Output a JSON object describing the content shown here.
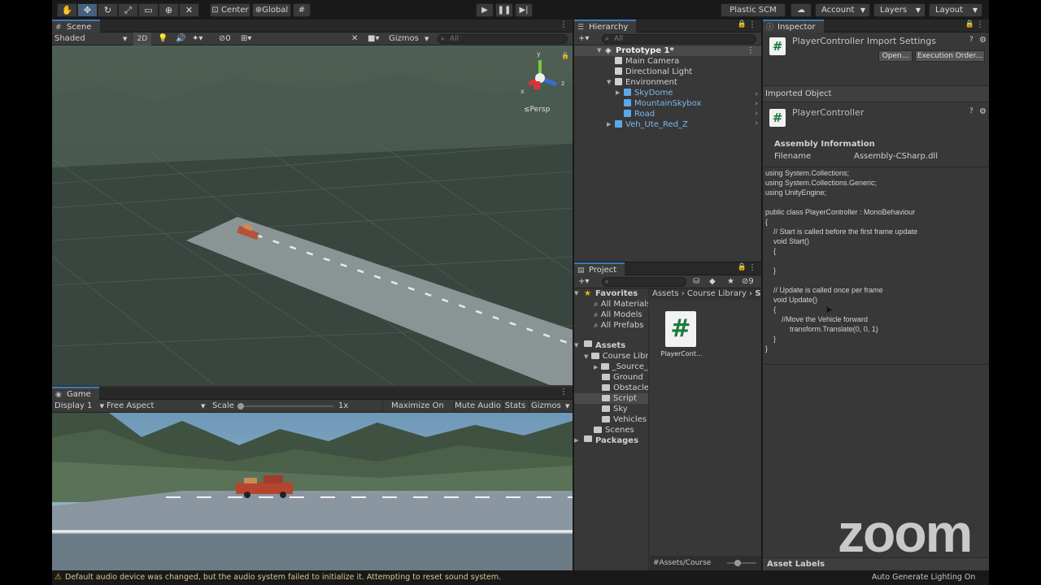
{
  "toolbar": {
    "pivot": "Center",
    "space": "Global",
    "plastic": "Plastic SCM",
    "account": "Account",
    "layers": "Layers",
    "layout": "Layout"
  },
  "scene": {
    "tab": "Scene",
    "shading": "Shaded",
    "mode_2d": "2D",
    "hidden_count": "0",
    "gizmos": "Gizmos",
    "search_placeholder": "All",
    "persp": "Persp",
    "axis_x": "x",
    "axis_y": "y",
    "axis_z": "z"
  },
  "game": {
    "tab": "Game",
    "display": "Display 1",
    "aspect": "Free Aspect",
    "scale_label": "Scale",
    "scale_value": "1x",
    "maximize": "Maximize On Play",
    "mute": "Mute Audio",
    "stats": "Stats",
    "gizmos": "Gizmos"
  },
  "hierarchy": {
    "tab": "Hierarchy",
    "search_placeholder": "All",
    "scene_name": "Prototype 1*",
    "items": [
      {
        "label": "Main Camera"
      },
      {
        "label": "Directional Light"
      },
      {
        "label": "Environment"
      },
      {
        "label": "SkyDome"
      },
      {
        "label": "MountainSkybox"
      },
      {
        "label": "Road"
      },
      {
        "label": "Veh_Ute_Red_Z"
      }
    ]
  },
  "project": {
    "tab": "Project",
    "hidden_count": "9",
    "favorites": "Favorites",
    "fav_items": [
      "All Materials",
      "All Models",
      "All Prefabs"
    ],
    "assets": "Assets",
    "asset_items": [
      "Course Library",
      "_Source_Files",
      "Ground",
      "Obstacles",
      "Script",
      "Sky",
      "Vehicles",
      "Scenes"
    ],
    "packages": "Packages",
    "breadcrumb": [
      "Assets",
      "Course Library",
      "Sc"
    ],
    "file_name": "PlayerCont...",
    "path_bar": "Assets/Course"
  },
  "inspector": {
    "tab": "Inspector",
    "title": "PlayerController Import Settings",
    "open_btn": "Open...",
    "exec_btn": "Execution Order...",
    "imported_object": "Imported Object",
    "object_name": "PlayerController",
    "assembly_info": "Assembly Information",
    "filename_label": "Filename",
    "filename_value": "Assembly-CSharp.dll",
    "code": "using System.Collections;\nusing System.Collections.Generic;\nusing UnityEngine;\n\npublic class PlayerController : MonoBehaviour\n{\n    // Start is called before the first frame update\n    void Start()\n    {\n\n    }\n\n    // Update is called once per frame\n    void Update()\n    {\n        //Move the Vehicle forward\n            transform.Translate(0, 0, 1)\n    }\n}",
    "asset_labels": "Asset Labels"
  },
  "status": {
    "message": "Default audio device was changed, but the audio system failed to initialize it. Attempting to reset sound system.",
    "right": "Auto Generate Lighting On"
  },
  "overlay": {
    "zoom_logo": "zoom"
  },
  "colors": {
    "accent": "#3a79bb",
    "panel": "#383838",
    "link_blue": "#7cb8f0",
    "script_green": "#1b7a3e"
  }
}
